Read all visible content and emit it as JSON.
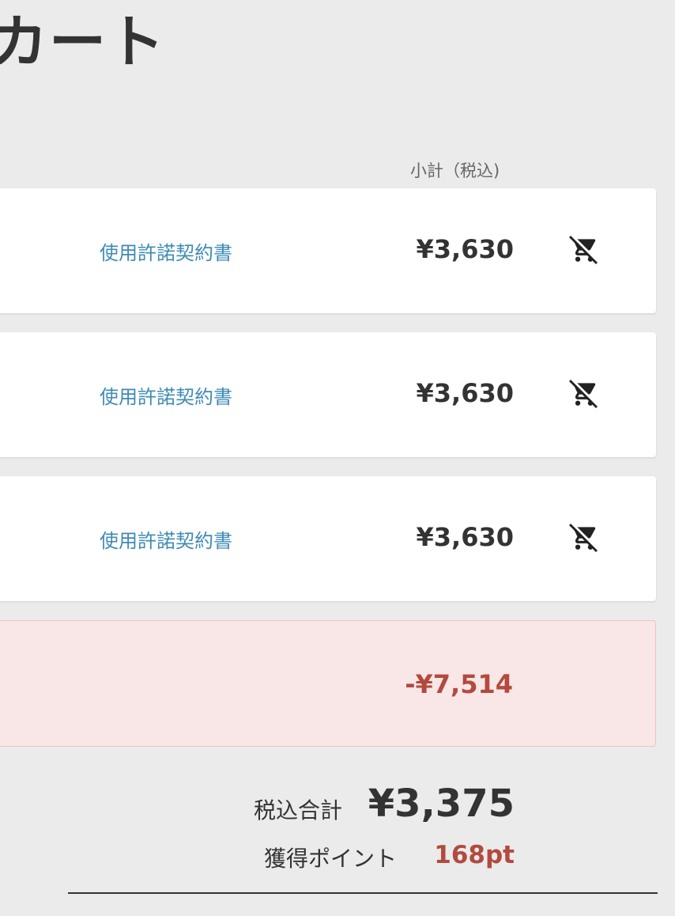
{
  "page": {
    "title": "カート"
  },
  "table": {
    "subtotal_header": "小計（税込)"
  },
  "cart": {
    "items": [
      {
        "name": "使用許諾契約書",
        "price": "¥3,630",
        "remove_icon": "remove-shopping-cart-icon"
      },
      {
        "name": "使用許諾契約書",
        "price": "¥3,630",
        "remove_icon": "remove-shopping-cart-icon"
      },
      {
        "name": "使用許諾契約書",
        "price": "¥3,630",
        "remove_icon": "remove-shopping-cart-icon"
      }
    ],
    "discount": "-¥7,514"
  },
  "summary": {
    "total_label": "税込合計",
    "total_value": "¥3,375",
    "points_label": "獲得ポイント",
    "points_value": "168pt"
  },
  "colors": {
    "background": "#ebebeb",
    "link": "#3f8bb5",
    "accent_red": "#b24a3e",
    "discount_background": "#f9e6e6",
    "text": "#333333"
  }
}
